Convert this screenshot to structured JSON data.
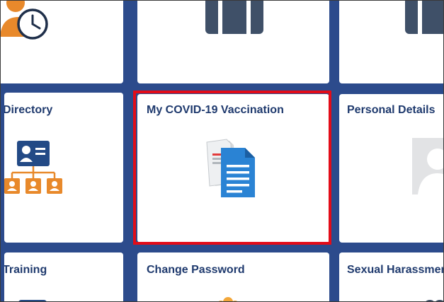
{
  "tiles": {
    "row2": [
      {
        "title": "Directory",
        "icon": "org-directory-icon"
      },
      {
        "title": "My COVID-19 Vaccination",
        "icon": "document-copy-icon",
        "highlighted": true
      },
      {
        "title": "Personal Details",
        "icon": "person-silhouette-icon"
      }
    ],
    "row3": [
      {
        "title": "Training",
        "icon": "training-icon"
      },
      {
        "title": "Change Password",
        "icon": "people-icon"
      },
      {
        "title": "Sexual Harassment",
        "icon": "sexual-harassment-icon"
      }
    ],
    "row1": [
      {
        "icon": "employee-clock-icon"
      },
      {
        "icon": "briefcase-icon"
      },
      {
        "icon": "briefcase-icon"
      }
    ]
  },
  "colors": {
    "background": "#2c4b8c",
    "title": "#1f3a6e",
    "highlight": "#e30c18",
    "orange": "#e8892b",
    "blue_icon": "#2a83d4"
  }
}
